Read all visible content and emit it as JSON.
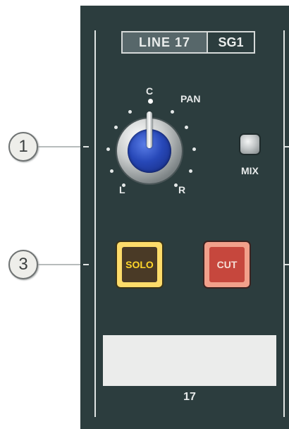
{
  "header": {
    "line_label": "LINE 17",
    "group_label": "SG1"
  },
  "pan": {
    "title": "PAN",
    "center_label": "C",
    "left_label": "L",
    "right_label": "R",
    "knob_position": "center"
  },
  "mix": {
    "label": "MIX",
    "led_state": "off"
  },
  "buttons": {
    "solo_label": "SOLO",
    "cut_label": "CUT"
  },
  "channel": {
    "scribble_text": "",
    "number": "17"
  },
  "callouts": [
    {
      "number": "1"
    },
    {
      "number": "3"
    }
  ],
  "colors": {
    "panel": "#2c3d3e",
    "knob_cap": "#2748b8",
    "solo_button": "#fddc6a",
    "cut_button": "#c6473d"
  }
}
